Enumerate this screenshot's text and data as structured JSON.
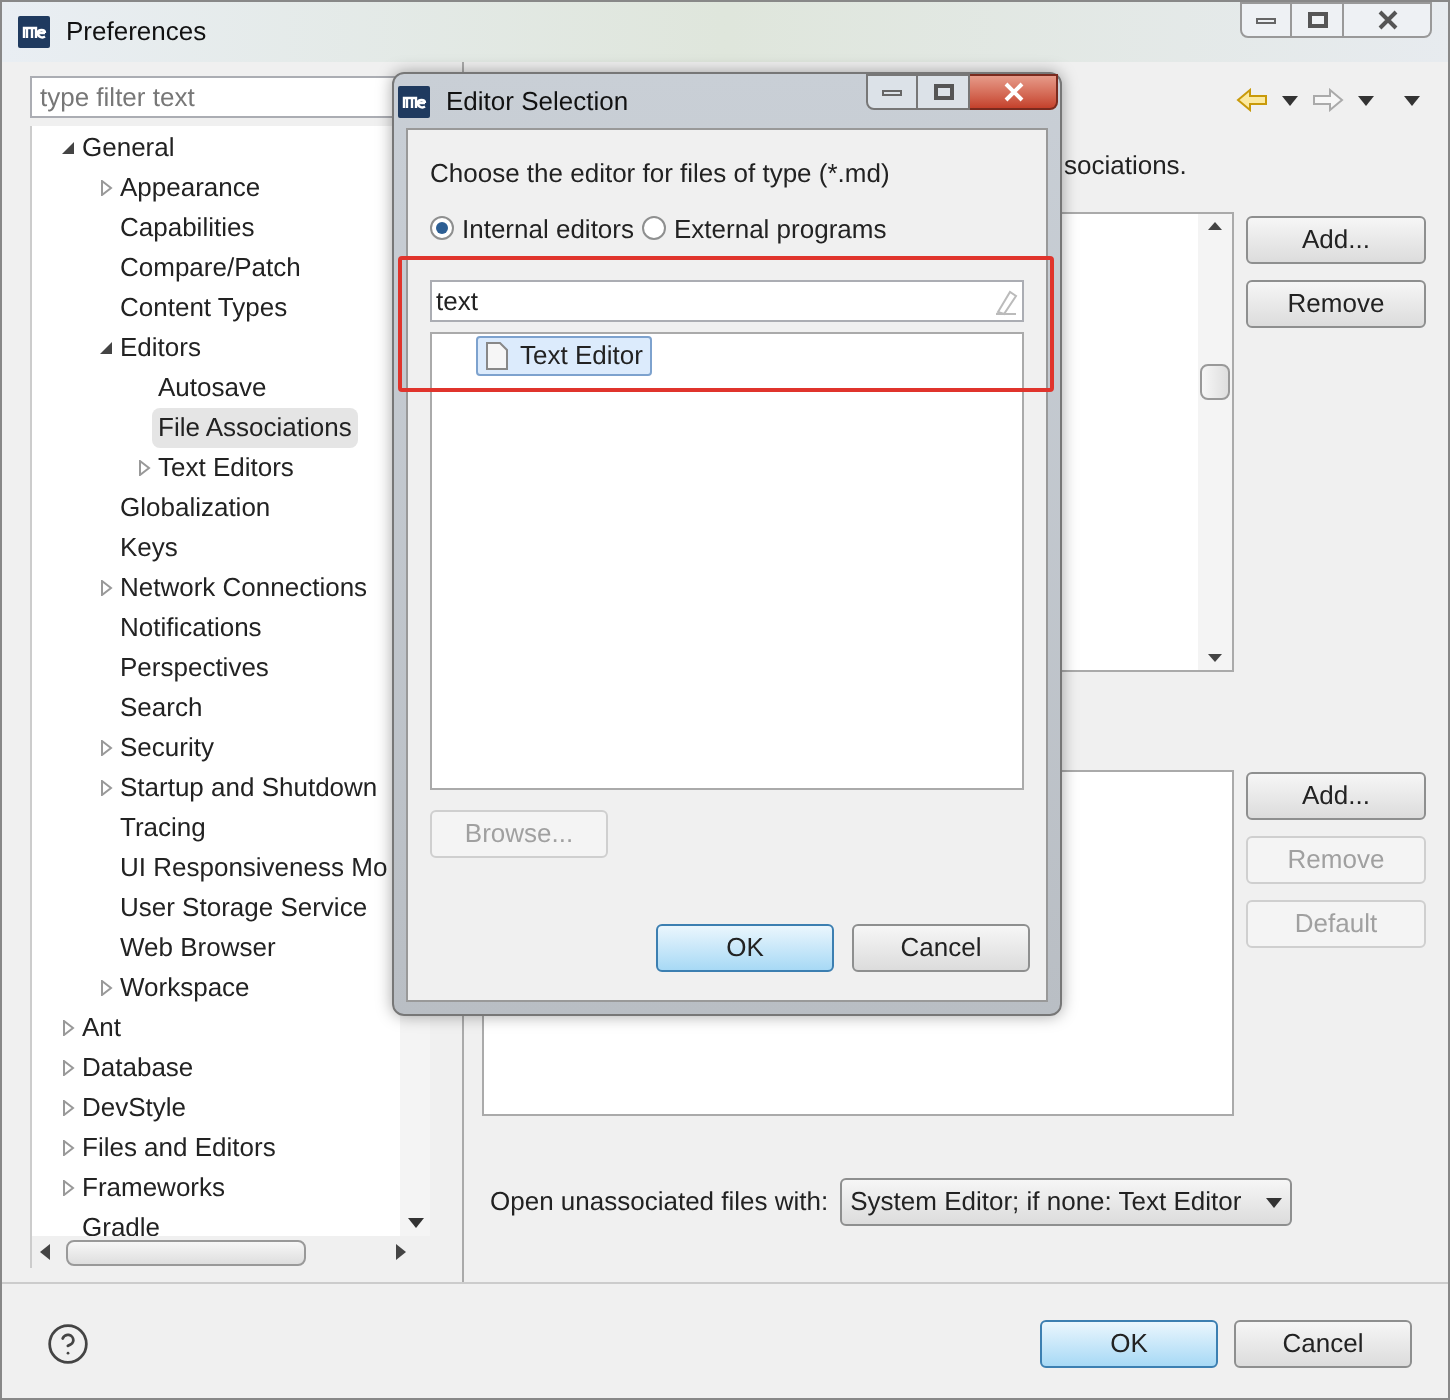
{
  "window": {
    "title": "Preferences"
  },
  "filter": {
    "placeholder": "type filter text"
  },
  "tree": [
    {
      "label": "General",
      "expanded": true,
      "selected": false,
      "children": [
        {
          "label": "Appearance",
          "expanded": false,
          "selected": false
        },
        {
          "label": "Capabilities",
          "selected": false
        },
        {
          "label": "Compare/Patch",
          "selected": false
        },
        {
          "label": "Content Types",
          "selected": false
        },
        {
          "label": "Editors",
          "expanded": true,
          "selected": false,
          "children": [
            {
              "label": "Autosave",
              "selected": false
            },
            {
              "label": "File Associations",
              "selected": true
            },
            {
              "label": "Text Editors",
              "expanded": false,
              "selected": false
            }
          ]
        },
        {
          "label": "Globalization",
          "selected": false
        },
        {
          "label": "Keys",
          "selected": false
        },
        {
          "label": "Network Connections",
          "expanded": false,
          "selected": false
        },
        {
          "label": "Notifications",
          "selected": false
        },
        {
          "label": "Perspectives",
          "selected": false
        },
        {
          "label": "Search",
          "selected": false
        },
        {
          "label": "Security",
          "expanded": false,
          "selected": false
        },
        {
          "label": "Startup and Shutdown",
          "expanded": false,
          "selected": false
        },
        {
          "label": "Tracing",
          "selected": false
        },
        {
          "label": "UI Responsiveness Mo",
          "selected": false
        },
        {
          "label": "User Storage Service",
          "selected": false
        },
        {
          "label": "Web Browser",
          "selected": false
        },
        {
          "label": "Workspace",
          "expanded": false,
          "selected": false
        }
      ]
    },
    {
      "label": "Ant",
      "expanded": false,
      "selected": false
    },
    {
      "label": "Database",
      "expanded": false,
      "selected": false
    },
    {
      "label": "DevStyle",
      "expanded": false,
      "selected": false
    },
    {
      "label": "Files and Editors",
      "expanded": false,
      "selected": false
    },
    {
      "label": "Frameworks",
      "expanded": false,
      "selected": false
    },
    {
      "label": "Gradle",
      "selected": false
    }
  ],
  "page": {
    "description": "sociations.",
    "file_type_buttons": [
      {
        "label": "Add...",
        "disabled": false
      },
      {
        "label": "Remove",
        "disabled": false
      }
    ],
    "editor_buttons": [
      {
        "label": "Add...",
        "disabled": false
      },
      {
        "label": "Remove",
        "disabled": true
      },
      {
        "label": "Default",
        "disabled": true
      }
    ],
    "unassociated": {
      "label": "Open unassociated files with:",
      "value": "System Editor; if none: Text Editor"
    }
  },
  "footer_buttons": [
    {
      "label": "OK",
      "default": true
    },
    {
      "label": "Cancel",
      "default": false
    }
  ],
  "dialog": {
    "title": "Editor Selection",
    "prompt": "Choose the editor for files of type (*.md)",
    "radios": [
      {
        "label": "Internal editors",
        "selected": true
      },
      {
        "label": "External programs",
        "selected": false
      }
    ],
    "filter_value": "text",
    "editors": [
      {
        "label": "Text Editor",
        "selected": true
      }
    ],
    "browse": {
      "label": "Browse...",
      "disabled": true
    },
    "buttons": [
      {
        "label": "OK",
        "default": true
      },
      {
        "label": "Cancel",
        "default": false
      }
    ]
  }
}
